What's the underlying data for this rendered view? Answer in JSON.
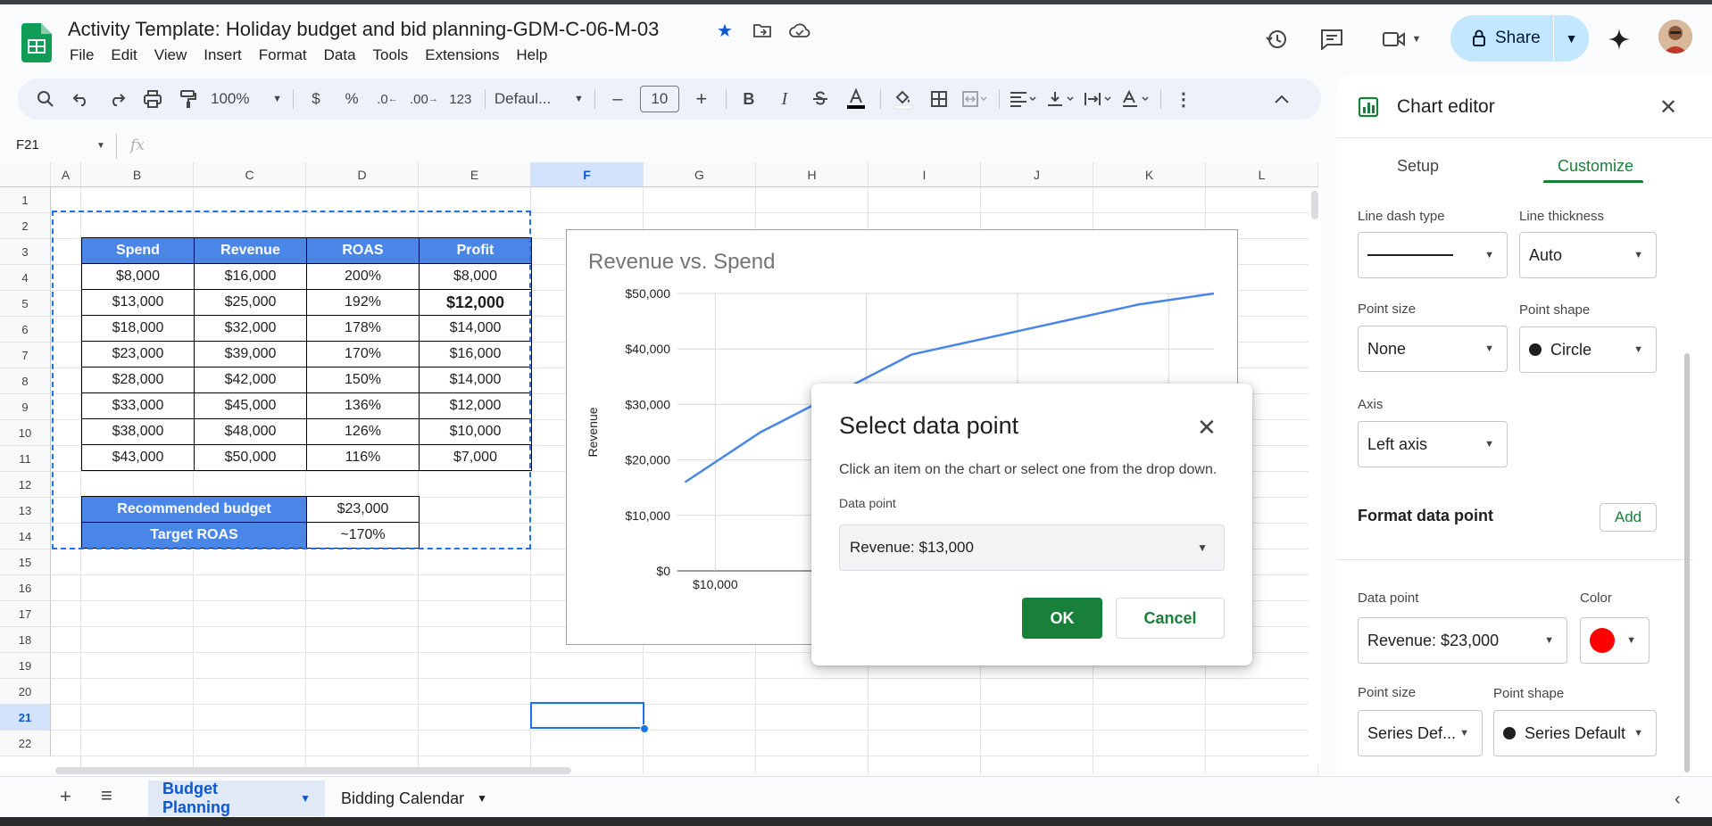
{
  "doc": {
    "title": "Activity Template: Holiday budget and bid planning-GDM-C-06-M-03",
    "menu": [
      "File",
      "Edit",
      "View",
      "Insert",
      "Format",
      "Data",
      "Tools",
      "Extensions",
      "Help"
    ],
    "share_label": "Share"
  },
  "toolbar": {
    "zoom": "100%",
    "currency": "$",
    "percent": "%",
    "dec_decrease": ".0",
    "dec_increase": ".00",
    "number_format": "123",
    "font": "Defaul...",
    "font_size": "10",
    "bold": "B",
    "italic": "I",
    "minus": "–",
    "plus": "+"
  },
  "formula_bar": {
    "name_box": "F21",
    "fx": "fx"
  },
  "columns": [
    "A",
    "B",
    "C",
    "D",
    "E",
    "F",
    "G",
    "H",
    "I",
    "J",
    "K",
    "L"
  ],
  "selected_column": "F",
  "rows": [
    "1",
    "2",
    "3",
    "4",
    "5",
    "6",
    "7",
    "8",
    "9",
    "10",
    "11",
    "12",
    "13",
    "14",
    "15",
    "16",
    "17",
    "18",
    "19",
    "20",
    "21",
    "22"
  ],
  "selected_row": "21",
  "table": {
    "headers": [
      "Spend",
      "Revenue",
      "ROAS",
      "Profit"
    ],
    "rows": [
      [
        "$8,000",
        "$16,000",
        "200%",
        "$8,000"
      ],
      [
        "$13,000",
        "$25,000",
        "192%",
        "$12,000"
      ],
      [
        "$18,000",
        "$32,000",
        "178%",
        "$14,000"
      ],
      [
        "$23,000",
        "$39,000",
        "170%",
        "$16,000"
      ],
      [
        "$28,000",
        "$42,000",
        "150%",
        "$14,000"
      ],
      [
        "$33,000",
        "$45,000",
        "136%",
        "$12,000"
      ],
      [
        "$38,000",
        "$48,000",
        "126%",
        "$10,000"
      ],
      [
        "$43,000",
        "$50,000",
        "116%",
        "$7,000"
      ]
    ],
    "summary": [
      {
        "label": "Recommended budget",
        "value": "$23,000"
      },
      {
        "label": "Target ROAS",
        "value": "~170%"
      }
    ]
  },
  "chart_data": {
    "type": "line",
    "title": "Revenue vs. Spend",
    "ylabel": "Revenue",
    "xlabel": "",
    "x": [
      8000,
      13000,
      18000,
      23000,
      28000,
      33000,
      38000,
      43000
    ],
    "series": [
      {
        "values": [
          16000,
          25000,
          32000,
          39000,
          42000,
          45000,
          48000,
          50000
        ],
        "color": "#4a86e8"
      }
    ],
    "ylim": [
      0,
      50000
    ],
    "yticks": [
      "$0",
      "$10,000",
      "$20,000",
      "$30,000",
      "$40,000",
      "$50,000"
    ],
    "xticks_visible": [
      "$10,000"
    ],
    "grid": true
  },
  "dialog": {
    "title": "Select data point",
    "description": "Click an item on the chart or select one from the drop down.",
    "field_label": "Data point",
    "selected": "Revenue: $13,000",
    "ok": "OK",
    "cancel": "Cancel"
  },
  "editor": {
    "title": "Chart editor",
    "tab_setup": "Setup",
    "tab_customize": "Customize",
    "line_dash_label": "Line dash type",
    "line_thickness_label": "Line thickness",
    "line_thickness_value": "Auto",
    "point_size_label": "Point size",
    "point_size_value": "None",
    "point_shape_label": "Point shape",
    "point_shape_value": "Circle",
    "axis_label": "Axis",
    "axis_value": "Left axis",
    "format_point_label": "Format data point",
    "add_label": "Add",
    "dp_label": "Data point",
    "dp_value": "Revenue: $23,000",
    "color_label": "Color",
    "color_value": "#ff0000",
    "dp_point_size_label": "Point size",
    "dp_point_size_value": "Series Def...",
    "dp_point_shape_label": "Point shape",
    "dp_point_shape_value": "Series Default"
  },
  "sheets": [
    {
      "name": "Budget Planning",
      "active": true
    },
    {
      "name": "Bidding Calendar",
      "active": false
    }
  ]
}
